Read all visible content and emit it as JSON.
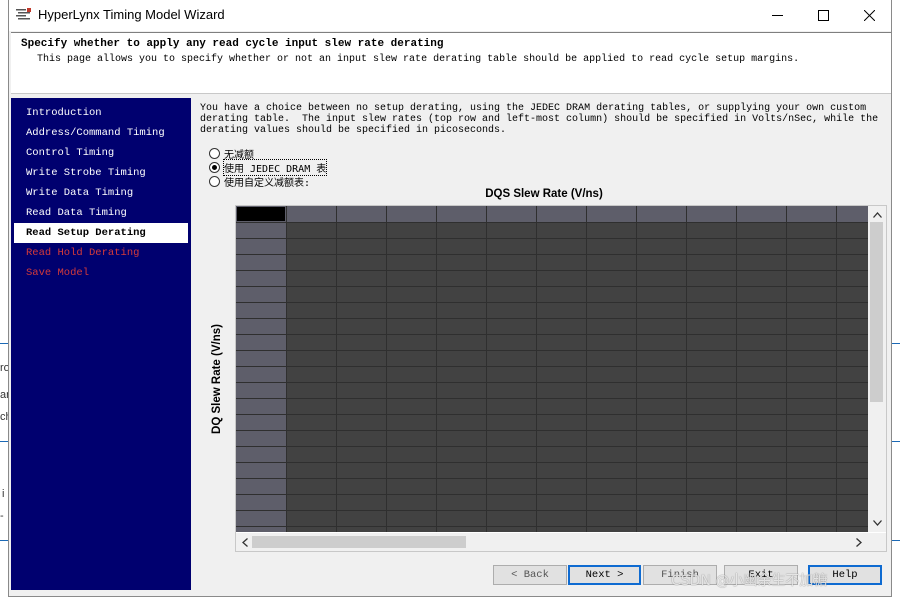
{
  "window": {
    "title": "HyperLynx Timing Model Wizard",
    "controls": [
      "minimize-icon",
      "maximize-icon",
      "close-icon"
    ]
  },
  "header": {
    "title": "Specify whether to apply any read cycle input slew rate derating",
    "subtitle": "This page allows you to specify whether or not an input slew rate derating table should be applied to read cycle setup margins."
  },
  "sidebar": {
    "items": [
      {
        "label": "Introduction",
        "state": "normal"
      },
      {
        "label": "Address/Command Timing",
        "state": "normal"
      },
      {
        "label": "Control Timing",
        "state": "normal"
      },
      {
        "label": "Write Strobe Timing",
        "state": "normal"
      },
      {
        "label": "Write Data Timing",
        "state": "normal"
      },
      {
        "label": "Read Data Timing",
        "state": "normal"
      },
      {
        "label": "Read Setup Derating",
        "state": "active"
      },
      {
        "label": "Read Hold Derating",
        "state": "disabled"
      },
      {
        "label": "Save Model",
        "state": "disabled"
      }
    ],
    "colors": {
      "background": "#00006f",
      "active_bg": "#ffffff",
      "disabled_text": "#d43a3a"
    }
  },
  "main": {
    "description": [
      "You have a choice between no setup derating, using the JEDEC DRAM derating tables, or supplying your own custom",
      "derating table.  The input slew rates (top row and left-most column) should be specified in Volts/nSec, while the",
      "derating values should be specified in picoseconds."
    ],
    "options": [
      {
        "label": "无减额",
        "selected": false
      },
      {
        "label": "使用 JEDEC DRAM 表",
        "selected": true
      },
      {
        "label": "使用自定义减额表:",
        "selected": false
      }
    ],
    "table": {
      "column_title": "DQS Slew Rate (V/ns)",
      "row_title": "DQ Slew Rate (V/ns)",
      "grid_color": "#424242",
      "header_color": "#5e5e6a"
    }
  },
  "buttons": {
    "back": "< Back",
    "next": "Next >",
    "finish": "Finish",
    "exit": "Exit",
    "help": "Help"
  },
  "watermark": "CSDN @小幽余生不加糖",
  "background_fragments": [
    "ro",
    "ar",
    "ch",
    "i",
    "-"
  ]
}
